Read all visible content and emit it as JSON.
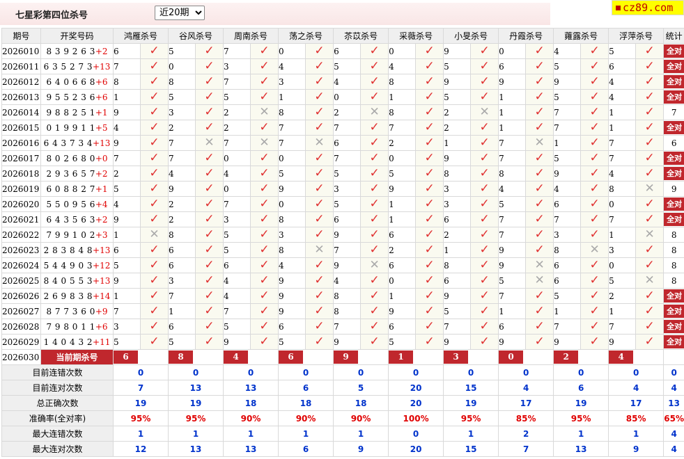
{
  "header": {
    "title": "七星彩第四位杀号",
    "period_select": {
      "selected": "近20期",
      "options": [
        "近20期"
      ]
    },
    "logo": "cz89.com"
  },
  "columns": {
    "period": "期号",
    "draw": "开奖号码",
    "experts": [
      "鸿雁杀号",
      "谷风杀号",
      "周南杀号",
      "荡之杀号",
      "苶苡杀号",
      "采薇杀号",
      "小旻杀号",
      "丹霞杀号",
      "蕹露杀号",
      "浮萍杀号"
    ],
    "stats": "统计"
  },
  "all_correct_label": "全对",
  "rows": [
    {
      "period": "2026010",
      "digits": "839263",
      "plus": "+2",
      "kills": [
        6,
        5,
        7,
        0,
        6,
        0,
        9,
        0,
        4,
        5
      ],
      "hits": [
        1,
        1,
        1,
        1,
        1,
        1,
        1,
        1,
        1,
        1
      ],
      "stat": "全对"
    },
    {
      "period": "2026011",
      "digits": "635273",
      "plus": "+13",
      "kills": [
        7,
        0,
        3,
        4,
        5,
        4,
        5,
        6,
        5,
        6
      ],
      "hits": [
        1,
        1,
        1,
        1,
        1,
        1,
        1,
        1,
        1,
        1
      ],
      "stat": "全对"
    },
    {
      "period": "2026012",
      "digits": "640668",
      "plus": "+6",
      "kills": [
        8,
        8,
        7,
        3,
        4,
        8,
        9,
        9,
        9,
        4
      ],
      "hits": [
        1,
        1,
        1,
        1,
        1,
        1,
        1,
        1,
        1,
        1
      ],
      "stat": "全对"
    },
    {
      "period": "2026013",
      "digits": "955236",
      "plus": "+6",
      "kills": [
        1,
        5,
        5,
        1,
        0,
        1,
        5,
        1,
        5,
        4
      ],
      "hits": [
        1,
        1,
        1,
        1,
        1,
        1,
        1,
        1,
        1,
        1
      ],
      "stat": "全对"
    },
    {
      "period": "2026014",
      "digits": "988251",
      "plus": "+1",
      "kills": [
        9,
        3,
        2,
        8,
        2,
        8,
        2,
        1,
        7,
        1
      ],
      "hits": [
        1,
        1,
        0,
        1,
        0,
        1,
        0,
        1,
        1,
        1
      ],
      "stat": "7"
    },
    {
      "period": "2026015",
      "digits": "019911",
      "plus": "+5",
      "kills": [
        4,
        2,
        2,
        7,
        7,
        7,
        2,
        1,
        7,
        1
      ],
      "hits": [
        1,
        1,
        1,
        1,
        1,
        1,
        1,
        1,
        1,
        1
      ],
      "stat": "全对"
    },
    {
      "period": "2026016",
      "digits": "643734",
      "plus": "+13",
      "kills": [
        9,
        7,
        7,
        7,
        6,
        2,
        1,
        7,
        1,
        7
      ],
      "hits": [
        1,
        0,
        0,
        0,
        1,
        1,
        1,
        0,
        1,
        1
      ],
      "stat": "6"
    },
    {
      "period": "2026017",
      "digits": "802680",
      "plus": "+0",
      "kills": [
        7,
        7,
        0,
        0,
        7,
        0,
        9,
        7,
        5,
        7
      ],
      "hits": [
        1,
        1,
        1,
        1,
        1,
        1,
        1,
        1,
        1,
        1
      ],
      "stat": "全对"
    },
    {
      "period": "2026018",
      "digits": "293657",
      "plus": "+2",
      "kills": [
        2,
        4,
        4,
        5,
        5,
        5,
        8,
        8,
        9,
        4
      ],
      "hits": [
        1,
        1,
        1,
        1,
        1,
        1,
        1,
        1,
        1,
        1
      ],
      "stat": "全对"
    },
    {
      "period": "2026019",
      "digits": "608827",
      "plus": "+1",
      "kills": [
        5,
        9,
        0,
        9,
        3,
        9,
        3,
        4,
        4,
        8
      ],
      "hits": [
        1,
        1,
        1,
        1,
        1,
        1,
        1,
        1,
        1,
        0
      ],
      "stat": "9"
    },
    {
      "period": "2026020",
      "digits": "550956",
      "plus": "+4",
      "kills": [
        4,
        2,
        7,
        0,
        5,
        1,
        3,
        5,
        6,
        0
      ],
      "hits": [
        1,
        1,
        1,
        1,
        1,
        1,
        1,
        1,
        1,
        1
      ],
      "stat": "全对"
    },
    {
      "period": "2026021",
      "digits": "643563",
      "plus": "+2",
      "kills": [
        9,
        2,
        3,
        8,
        6,
        1,
        6,
        7,
        7,
        7
      ],
      "hits": [
        1,
        1,
        1,
        1,
        1,
        1,
        1,
        1,
        1,
        1
      ],
      "stat": "全对"
    },
    {
      "period": "2026022",
      "digits": "799102",
      "plus": "+3",
      "kills": [
        1,
        8,
        5,
        3,
        9,
        6,
        2,
        7,
        3,
        1
      ],
      "hits": [
        0,
        1,
        1,
        1,
        1,
        1,
        1,
        1,
        1,
        0
      ],
      "stat": "8"
    },
    {
      "period": "2026023",
      "digits": "283848",
      "plus": "+13",
      "kills": [
        6,
        6,
        5,
        8,
        7,
        2,
        1,
        9,
        8,
        3
      ],
      "hits": [
        1,
        1,
        1,
        0,
        1,
        1,
        1,
        1,
        0,
        1
      ],
      "stat": "8"
    },
    {
      "period": "2026024",
      "digits": "544903",
      "plus": "+12",
      "kills": [
        5,
        6,
        6,
        4,
        9,
        6,
        8,
        9,
        6,
        0
      ],
      "hits": [
        1,
        1,
        1,
        1,
        0,
        1,
        1,
        0,
        1,
        1
      ],
      "stat": "8"
    },
    {
      "period": "2026025",
      "digits": "840553",
      "plus": "+13",
      "kills": [
        9,
        3,
        4,
        9,
        4,
        0,
        6,
        5,
        6,
        5
      ],
      "hits": [
        1,
        1,
        1,
        1,
        1,
        1,
        1,
        0,
        1,
        0
      ],
      "stat": "8"
    },
    {
      "period": "2026026",
      "digits": "269838",
      "plus": "+14",
      "kills": [
        1,
        7,
        4,
        9,
        8,
        1,
        9,
        7,
        5,
        2
      ],
      "hits": [
        1,
        1,
        1,
        1,
        1,
        1,
        1,
        1,
        1,
        1
      ],
      "stat": "全对"
    },
    {
      "period": "2026027",
      "digits": "877360",
      "plus": "+9",
      "kills": [
        7,
        1,
        7,
        9,
        8,
        9,
        5,
        1,
        1,
        1
      ],
      "hits": [
        1,
        1,
        1,
        1,
        1,
        1,
        1,
        1,
        1,
        1
      ],
      "stat": "全对"
    },
    {
      "period": "2026028",
      "digits": "798011",
      "plus": "+6",
      "kills": [
        3,
        6,
        5,
        6,
        7,
        6,
        7,
        6,
        7,
        7
      ],
      "hits": [
        1,
        1,
        1,
        1,
        1,
        1,
        1,
        1,
        1,
        1
      ],
      "stat": "全对"
    },
    {
      "period": "2026029",
      "digits": "140432",
      "plus": "+11",
      "kills": [
        5,
        5,
        9,
        5,
        9,
        5,
        9,
        9,
        9,
        9
      ],
      "hits": [
        1,
        1,
        1,
        1,
        1,
        1,
        1,
        1,
        1,
        1
      ],
      "stat": "全对"
    }
  ],
  "current": {
    "period": "2026030",
    "label": "当前期杀号",
    "kills": [
      6,
      8,
      4,
      6,
      9,
      1,
      3,
      0,
      2,
      4
    ]
  },
  "summary": [
    {
      "label": "目前连错次数",
      "values": [
        0,
        0,
        0,
        0,
        0,
        0,
        0,
        0,
        0,
        0
      ],
      "total": "0",
      "red": false
    },
    {
      "label": "目前连对次数",
      "values": [
        7,
        13,
        13,
        6,
        5,
        20,
        15,
        4,
        6,
        4
      ],
      "total": "4",
      "red": false
    },
    {
      "label": "总正确次数",
      "values": [
        19,
        19,
        18,
        18,
        18,
        20,
        19,
        17,
        19,
        17
      ],
      "total": "13",
      "red": false
    },
    {
      "label": "准确率(全对率)",
      "values": [
        "95%",
        "95%",
        "90%",
        "90%",
        "90%",
        "100%",
        "95%",
        "85%",
        "95%",
        "85%"
      ],
      "total": "65%",
      "red": true
    },
    {
      "label": "最大连错次数",
      "values": [
        1,
        1,
        1,
        1,
        1,
        0,
        1,
        2,
        1,
        1
      ],
      "total": "4",
      "red": false
    },
    {
      "label": "最大连对次数",
      "values": [
        12,
        13,
        13,
        6,
        9,
        20,
        15,
        7,
        13,
        9
      ],
      "total": "4",
      "red": false
    }
  ],
  "colors": {
    "accent_red": "#c0272d",
    "check_red": "#e03030",
    "stat_blue": "#0033cc",
    "header_bg": "#efefef"
  }
}
